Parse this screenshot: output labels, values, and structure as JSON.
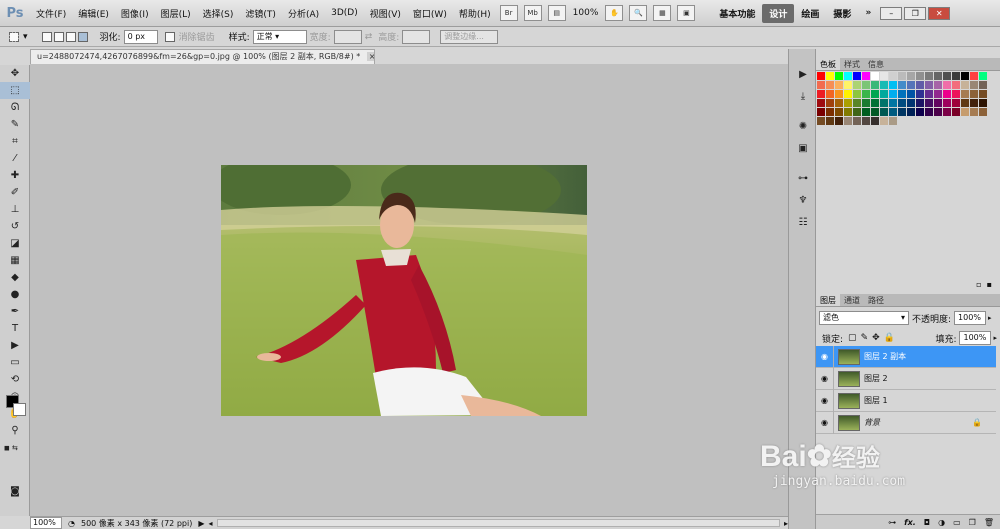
{
  "app": {
    "logo": "Ps"
  },
  "menu": [
    "文件(F)",
    "编辑(E)",
    "图像(I)",
    "图层(L)",
    "选择(S)",
    "滤镜(T)",
    "分析(A)",
    "3D(D)",
    "视图(V)",
    "窗口(W)",
    "帮助(H)"
  ],
  "toolbar": {
    "br": "Br",
    "mb": "Mb",
    "zoom": "100%"
  },
  "workspaces": [
    "基本功能",
    "设计",
    "绘画",
    "摄影",
    "»"
  ],
  "workspace_active": "设计",
  "options": {
    "feather_label": "羽化:",
    "feather_value": "0 px",
    "antialias_label": "消除锯齿",
    "style_label": "样式:",
    "style_value": "正常",
    "width_label": "宽度:",
    "height_label": "高度:",
    "refine_button": "调整边缘..."
  },
  "document": {
    "tab_title": "u=2488072474,4267076899&fm=26&gp=0.jpg @ 100% (图层 2 副本, RGB/8#) *",
    "tab_close": "×"
  },
  "status": {
    "zoom": "100%",
    "info": "500 像素 x 343 像素 (72 ppi)"
  },
  "panels": {
    "color_tabs": [
      "色板",
      "样式",
      "信息"
    ],
    "layers_tabs": [
      "图层",
      "通道",
      "路径"
    ],
    "blend_mode": "滤色",
    "opacity_label": "不透明度:",
    "opacity_value": "100%",
    "lock_label": "锁定:",
    "fill_label": "填充:",
    "fill_value": "100%"
  },
  "layers": [
    {
      "name": "图层 2 副本",
      "selected": true
    },
    {
      "name": "图层 2",
      "selected": false
    },
    {
      "name": "图层 1",
      "selected": false
    },
    {
      "name": "背景",
      "selected": false,
      "locked": true
    }
  ],
  "footer_icons": [
    "link-icon",
    "fx-icon",
    "mask-icon",
    "adjustment-icon",
    "folder-icon",
    "new-layer-icon",
    "trash-icon"
  ],
  "watermark": {
    "brand": "Bai",
    "brand2": "经验",
    "url": "jingyan.baidu.com"
  },
  "colors": {
    "selected_layer": "#3d96f5",
    "canvas_bg": "#c0c0c0",
    "shirt": "#b5162b"
  }
}
